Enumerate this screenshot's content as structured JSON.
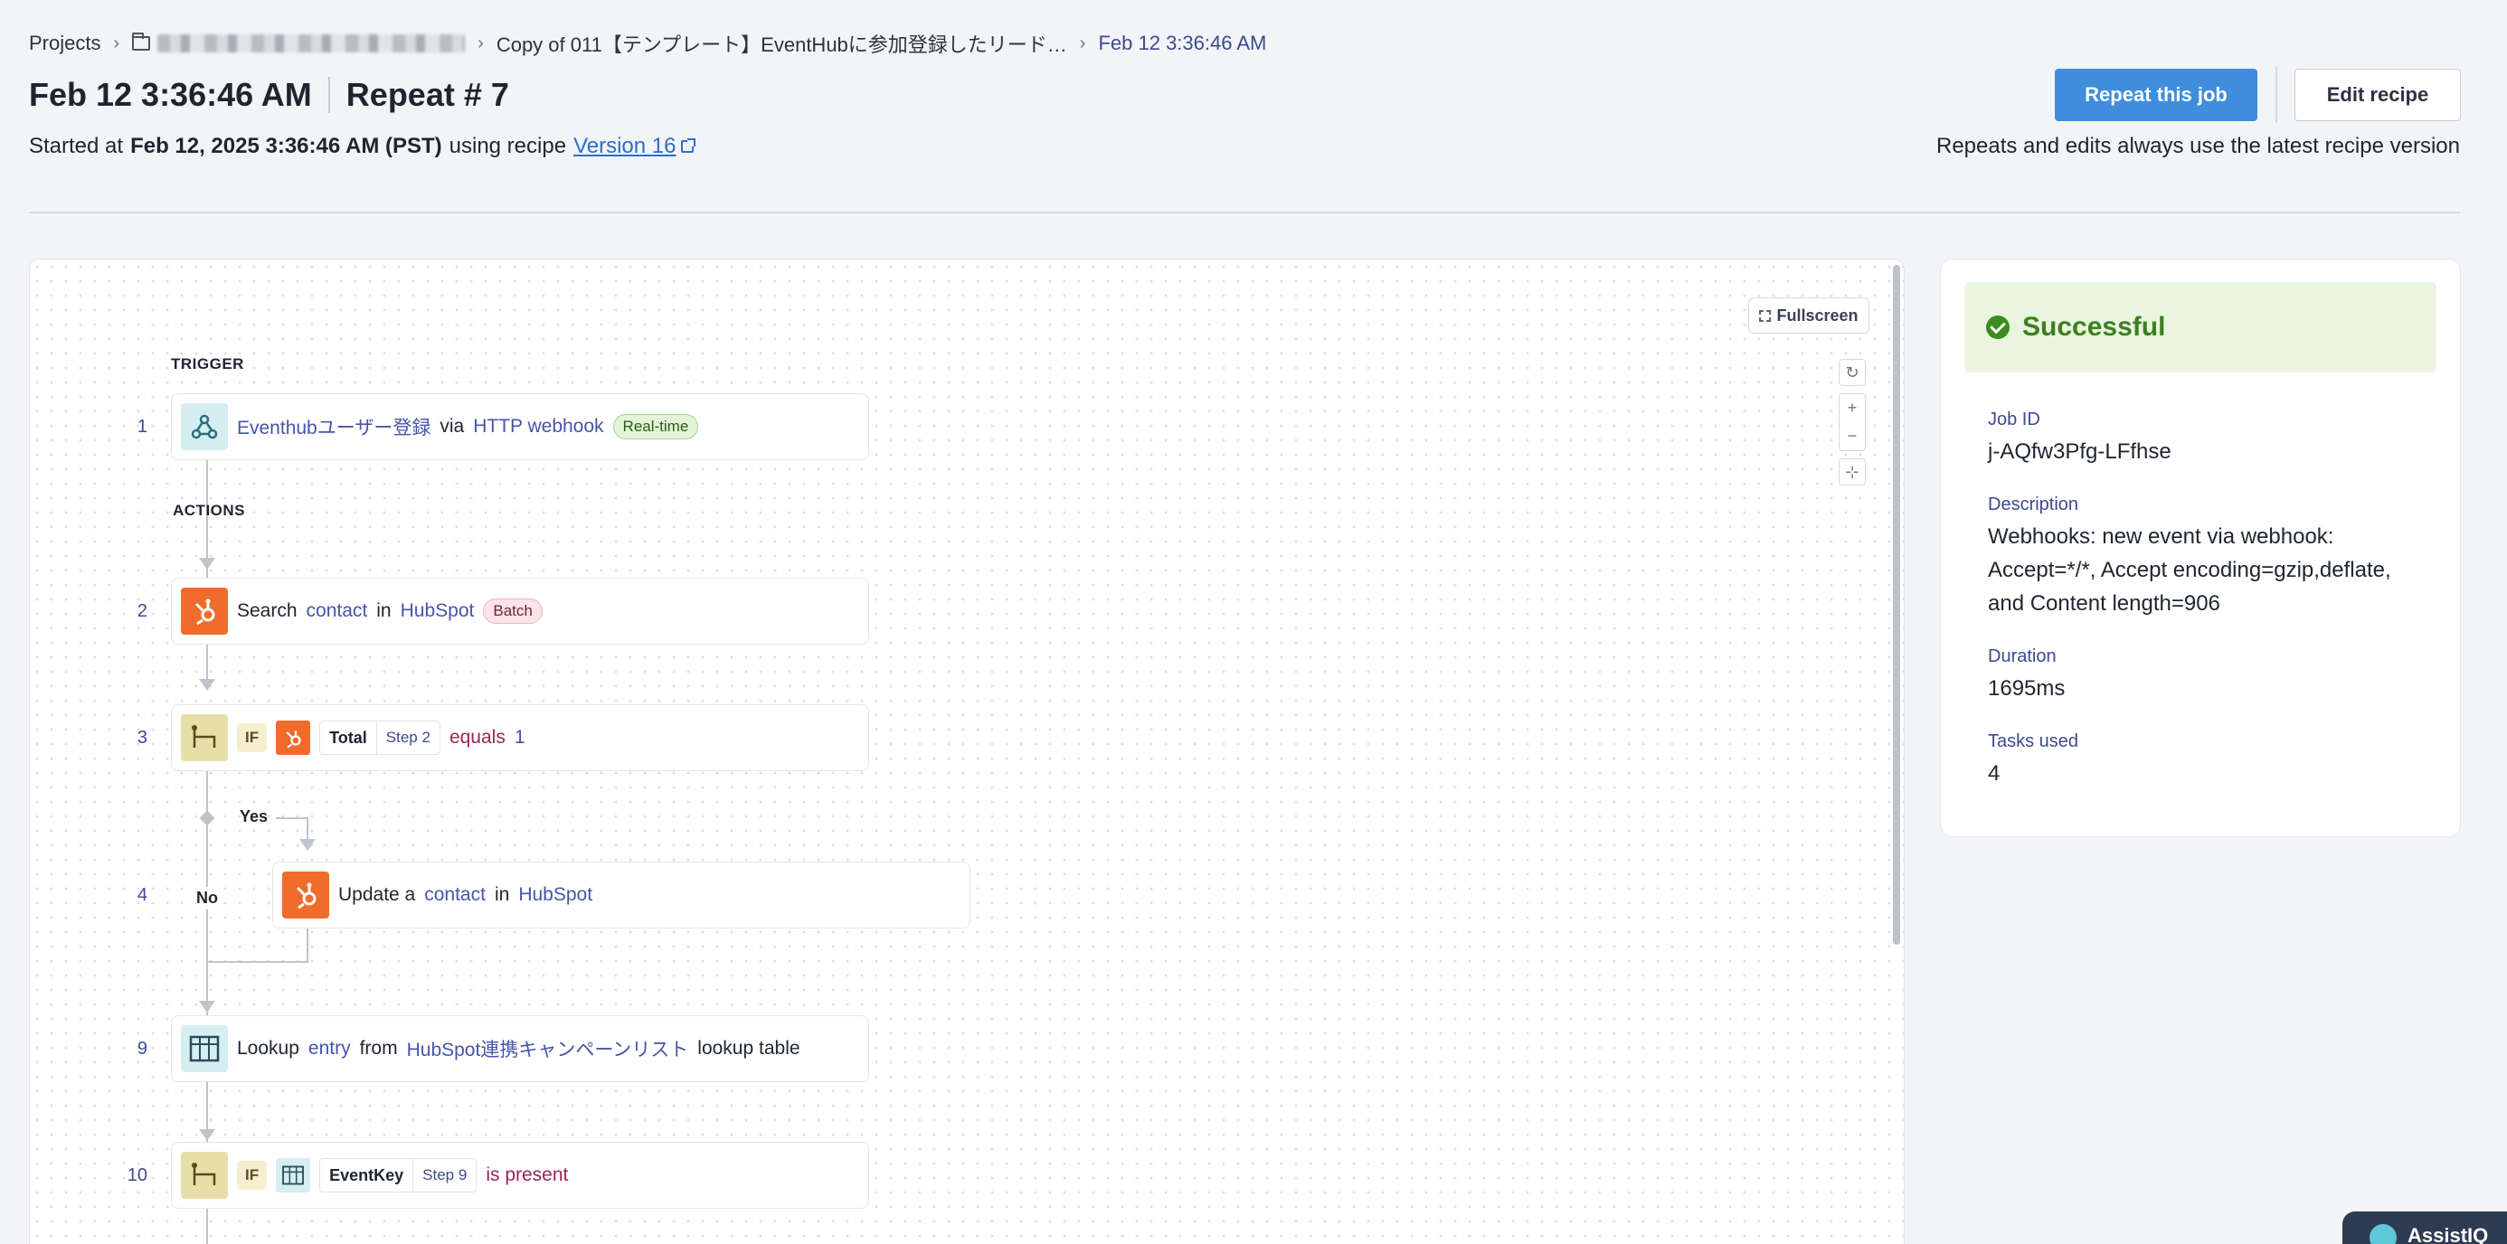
{
  "breadcrumb": {
    "projects": "Projects",
    "recipe": "Copy of 011【テンプレート】EventHubに参加登録したリード…",
    "current": "Feb 12 3:36:46 AM"
  },
  "header": {
    "title": "Feb 12 3:36:46 AM",
    "repeat": "Repeat # 7",
    "started_prefix": "Started at",
    "started_at": "Feb 12, 2025 3:36:46 AM (PST)",
    "using_recipe": "using recipe",
    "version": "Version 16",
    "repeat_button": "Repeat this job",
    "edit_button": "Edit recipe",
    "hint": "Repeats and edits always use the latest recipe version"
  },
  "canvas": {
    "fullscreen": "Fullscreen",
    "trigger_label": "TRIGGER",
    "actions_label": "ACTIONS",
    "steps": {
      "s1": {
        "num": "1",
        "app": "Eventhubユーザー登録",
        "via": "via",
        "connector": "HTTP webhook",
        "badge": "Real-time"
      },
      "s2": {
        "num": "2",
        "verb": "Search",
        "object": "contact",
        "in": "in",
        "app": "HubSpot",
        "badge": "Batch"
      },
      "s3": {
        "num": "3",
        "if": "IF",
        "field": "Total",
        "step": "Step 2",
        "op": "equals",
        "value": "1"
      },
      "s4": {
        "num": "4",
        "verb": "Update a",
        "object": "contact",
        "in": "in",
        "app": "HubSpot"
      },
      "s9": {
        "num": "9",
        "verb": "Lookup",
        "object": "entry",
        "from": "from",
        "table": "HubSpot連携キャンペーンリスト",
        "suffix": "lookup table"
      },
      "s10": {
        "num": "10",
        "if": "IF",
        "field": "EventKey",
        "step": "Step 9",
        "op": "is present"
      }
    },
    "branch_yes": "Yes",
    "branch_no": "No"
  },
  "panel": {
    "status": "Successful",
    "job_id_label": "Job ID",
    "job_id": "j-AQfw3Pfg-LFfhse",
    "description_label": "Description",
    "description": "Webhooks: new event via webhook: Accept=*/*, Accept encoding=gzip,deflate, and Content length=906",
    "duration_label": "Duration",
    "duration": "1695ms",
    "tasks_label": "Tasks used",
    "tasks": "4"
  },
  "assist": {
    "label": "AssistIQ"
  },
  "colors": {
    "primary": "#3f8edc",
    "success_bg": "#e9f5df",
    "success_text": "#3d7f1f",
    "hubspot": "#ef6c2b",
    "link": "#4655a8"
  }
}
